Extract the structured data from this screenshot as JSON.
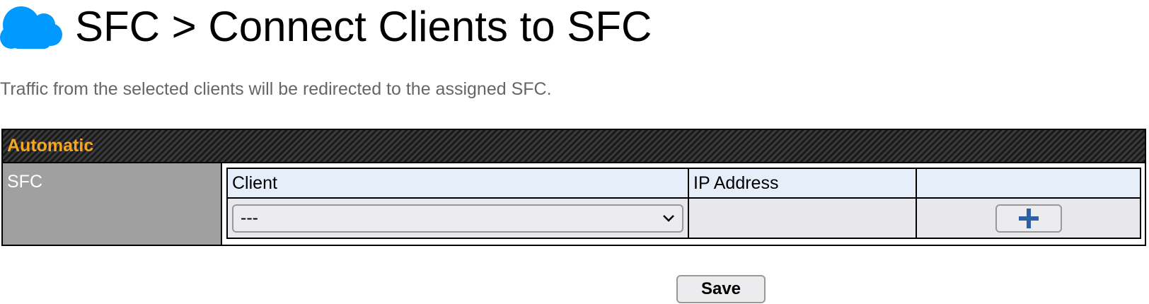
{
  "header": {
    "icon": "cloud-icon",
    "title": "SFC > Connect Clients to SFC"
  },
  "description": "Traffic from the selected clients will be redirected to the assigned SFC.",
  "panel": {
    "header_label": "Automatic",
    "row_label": "SFC",
    "table": {
      "columns": [
        "Client",
        "IP Address",
        ""
      ],
      "client_select_value": "---",
      "ip_address_value": ""
    },
    "add_icon": "plus-icon"
  },
  "actions": {
    "save_label": "Save"
  },
  "colors": {
    "cloud": "#0099ff",
    "header_label": "#f5a623",
    "label_cell_bg": "#a0a0a0",
    "table_header_bg": "#e6eefa",
    "plus": "#2d5fa6"
  }
}
